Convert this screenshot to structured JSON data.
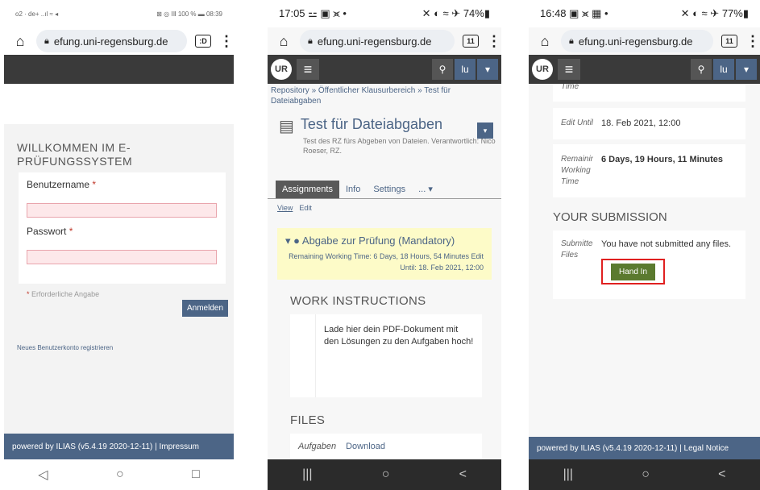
{
  "panel1": {
    "status_left": "o2 · de+ ..ıl ≈ ◂",
    "status_right": "⊠ ◎ ⅠⅡ 100 % ▬ 08:39",
    "url": "efung.uni-regensburg.de",
    "tabs": ":D",
    "title": "WILLKOMMEN IM E-PRÜFUNGSSYSTEM",
    "username_label": "Benutzername",
    "password_label": "Passwort",
    "required_mark": "*",
    "required_note": "Erforderliche Angabe",
    "login_button": "Anmelden",
    "register_link": "Neues Benutzerkonto registrieren",
    "footer": "powered by ILIAS (v5.4.19 2020-12-11) | Impressum",
    "nav": [
      "◁",
      "○",
      "□"
    ]
  },
  "panel2": {
    "status_left": "17:05 ⚍ ▣ ⪤ •",
    "status_right": "✕ ◐ ≈ ✈ 74%▮",
    "url": "efung.uni-regensburg.de",
    "tabs": "11",
    "user": "lu",
    "logo": "UR",
    "breadcrumb": "Repository » Öffentlicher Klausurbereich » Test für Dateiabgaben",
    "object_title": "Test für Dateiabgaben",
    "object_desc": "Test des RZ fürs Abgeben von Dateien. Verantwortlich: Nico Roeser, RZ.",
    "tabs_list": [
      "Assignments",
      "Info",
      "Settings",
      "... ▾"
    ],
    "subtabs": [
      "View",
      "Edit"
    ],
    "assignment_title": "Abgabe zur Prüfung (Mandatory)",
    "assignment_meta": "Remaining Working Time: 6 Days, 18 Hours, 54 Minutes     Edit Until: 18. Feb 2021, 12:00",
    "work_instructions_heading": "WORK INSTRUCTIONS",
    "work_instructions_text": "Lade hier dein PDF-Dokument mit den Lösungen zu den Aufgaben hoch!",
    "files_heading": "FILES",
    "file_name": "Aufgaben",
    "file_action": "Download",
    "nav": [
      "|||",
      "○",
      "<"
    ]
  },
  "panel3": {
    "status_left": "16:48 ▣ ⪤ ▦ •",
    "status_right": "✕ ◐ ≈ ✈ 77%▮",
    "url": "efung.uni-regensburg.de",
    "tabs": "11",
    "user": "lu",
    "logo": "UR",
    "partial_label": "Time",
    "edit_until_label": "Edit Until",
    "edit_until_value": "18. Feb 2021, 12:00",
    "remaining_label": "Remaining Working Time",
    "remaining_value": "6 Days, 19 Hours, 11 Minutes",
    "submission_heading": "YOUR SUBMISSION",
    "submitted_label": "Submitted Files",
    "submitted_value": "You have not submitted any files.",
    "hand_in_button": "Hand In",
    "footer": "powered by ILIAS (v5.4.19 2020-12-11) | Legal Notice",
    "nav": [
      "|||",
      "○",
      "<"
    ]
  }
}
